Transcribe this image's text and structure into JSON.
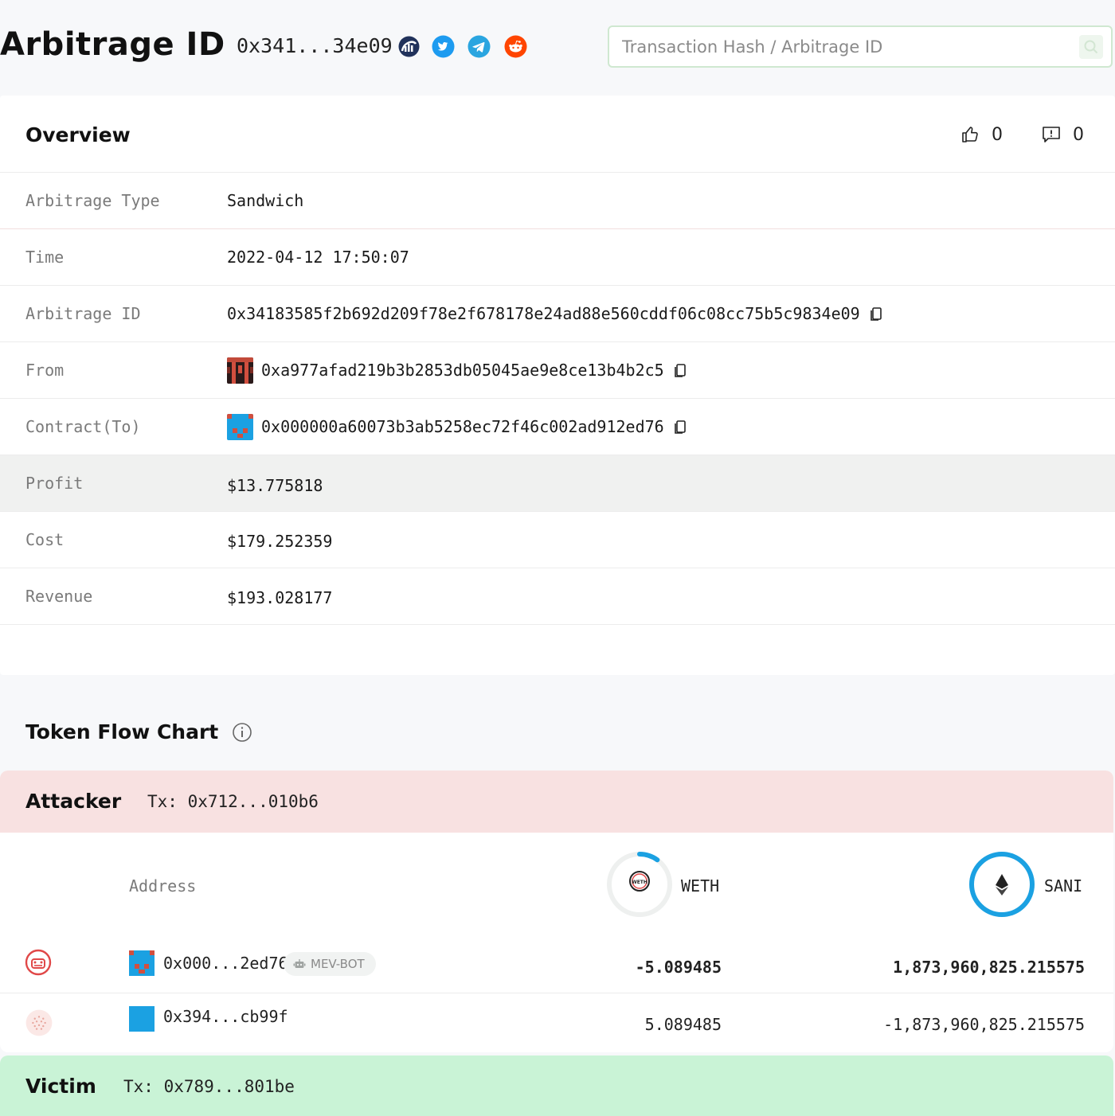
{
  "header": {
    "title": "Arbitrage ID",
    "short_hash": "0x341...34e09",
    "search_placeholder": "Transaction Hash / Arbitrage ID"
  },
  "overview": {
    "title": "Overview",
    "likes": "0",
    "reports": "0",
    "rows": [
      {
        "label": "Arbitrage Type",
        "value": "Sandwich"
      },
      {
        "label": "Time",
        "value": "2022-04-12 17:50:07"
      },
      {
        "label": "Arbitrage ID",
        "value": "0x34183585f2b692d209f78e2f678178e24ad88e560cddf06c08cc75b5c9834e09"
      },
      {
        "label": "From",
        "value": "0xa977afad219b3b2853db05045ae9e8ce13b4b2c5"
      },
      {
        "label": "Contract(To)",
        "value": "0x000000a60073b3ab5258ec72f46c002ad912ed76"
      },
      {
        "label": "Profit",
        "value": "$13.775818"
      },
      {
        "label": "Cost",
        "value": "$179.252359"
      },
      {
        "label": "Revenue",
        "value": "$193.028177"
      }
    ]
  },
  "token_flow": {
    "title": "Token Flow Chart",
    "attacker": {
      "role": "Attacker",
      "tx": "Tx:  0x712...010b6",
      "address_header": "Address",
      "tokens": [
        {
          "symbol": "WETH",
          "icon": "weth-token-icon",
          "ring_fraction": 0.1
        },
        {
          "symbol": "SANI",
          "icon": "eth-token-icon",
          "ring_fraction": 1.0
        }
      ],
      "rows": [
        {
          "address": "0x000...2ed76",
          "badge": "MEV-BOT",
          "weth": "-5.089485",
          "sani": "1,873,960,825.215575"
        },
        {
          "address": "0x394...cb99f",
          "weth": "5.089485",
          "sani": "-1,873,960,825.215575"
        }
      ]
    },
    "victim": {
      "role": "Victim",
      "tx": "Tx:  0x789...801be"
    }
  },
  "colors": {
    "accent_blue": "#1ba1e2",
    "attacker_bg": "#f8e1e1",
    "victim_bg": "#c9f3d6",
    "bot_red": "#e04848"
  }
}
